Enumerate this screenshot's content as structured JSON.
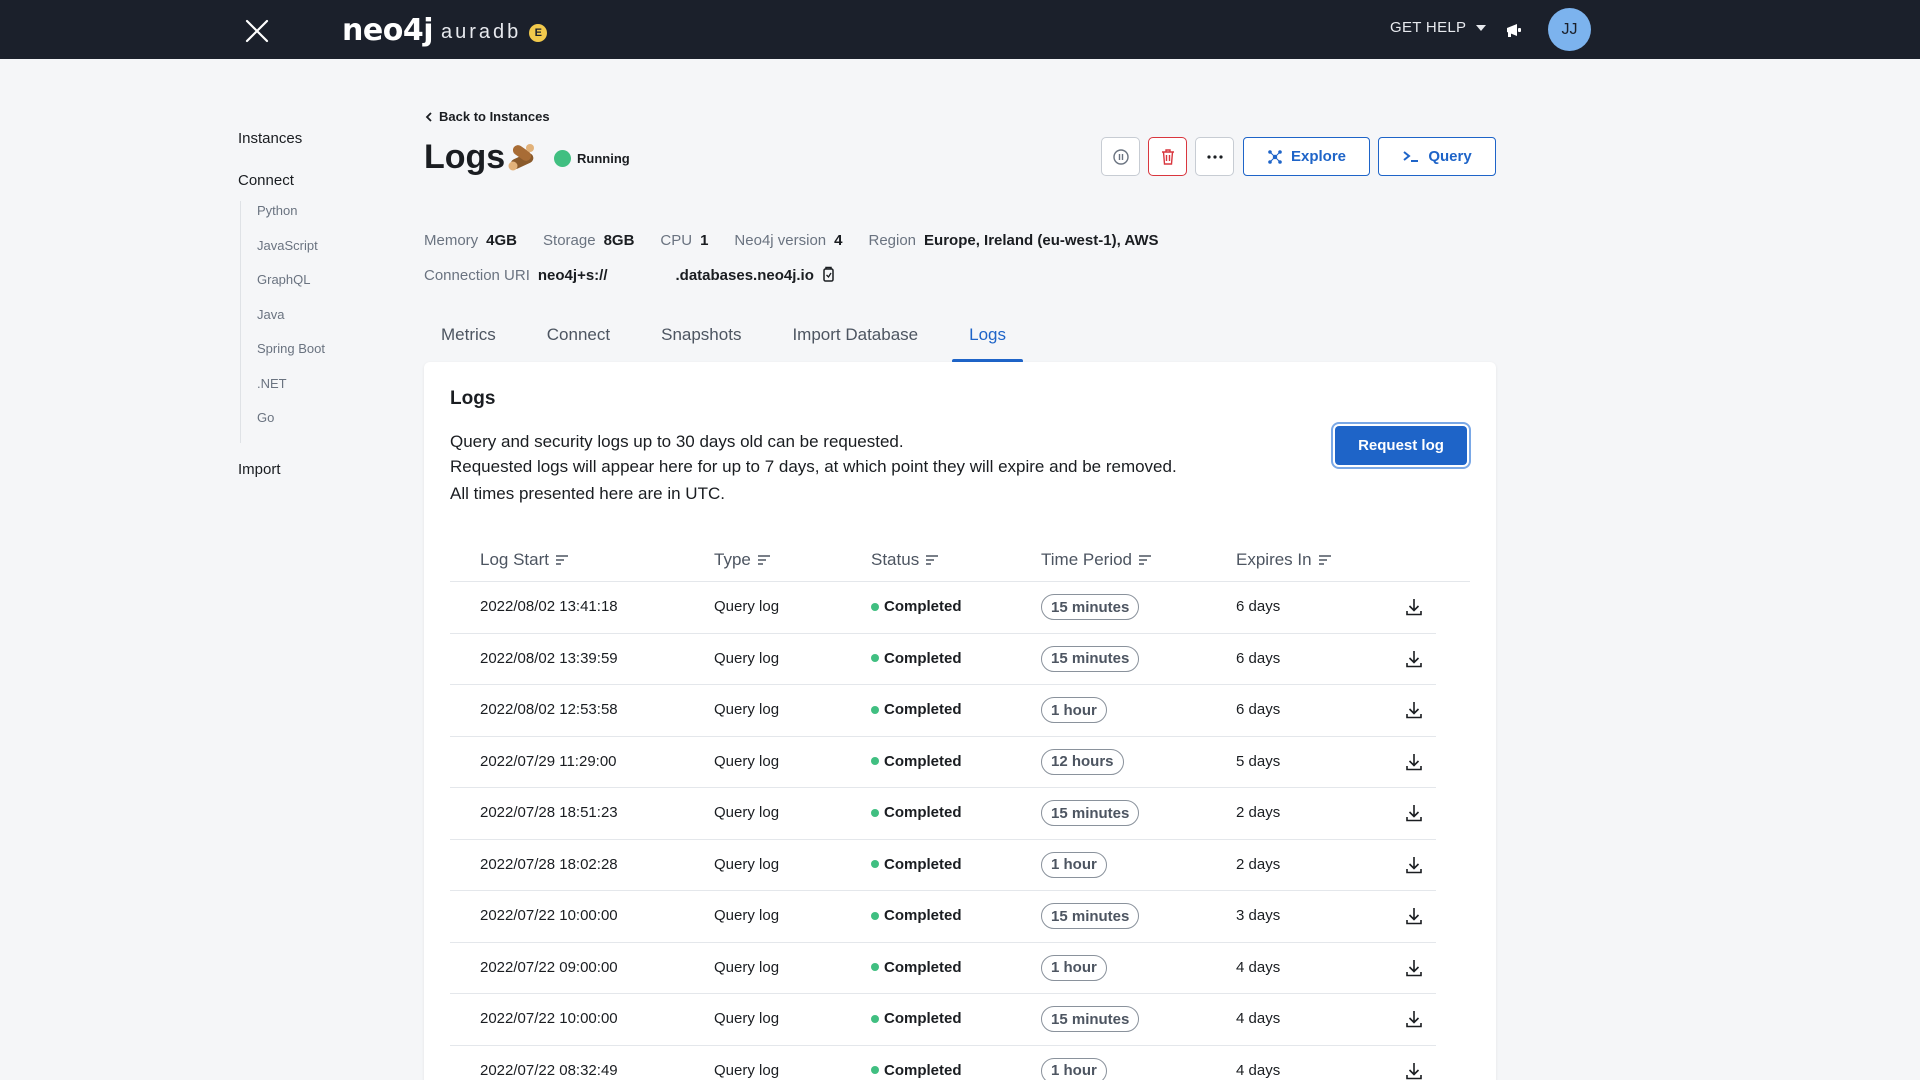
{
  "topbar": {
    "logo_main": "neo4j",
    "logo_sub": "auradb",
    "logo_badge": "E",
    "help_label": "GET HELP",
    "avatar_initials": "JJ"
  },
  "sidebar": {
    "instances": "Instances",
    "connect": "Connect",
    "connect_items": [
      "Python",
      "JavaScript",
      "GraphQL",
      "Java",
      "Spring Boot",
      ".NET",
      "Go"
    ],
    "import": "Import"
  },
  "header": {
    "back_label": "Back to Instances",
    "title": "Logs",
    "status": "Running",
    "explore_label": "Explore",
    "query_label": "Query"
  },
  "meta": {
    "memory_label": "Memory",
    "memory_value": "4GB",
    "storage_label": "Storage",
    "storage_value": "8GB",
    "cpu_label": "CPU",
    "cpu_value": "1",
    "version_label": "Neo4j version",
    "version_value": "4",
    "region_label": "Region",
    "region_value": "Europe, Ireland (eu-west-1), AWS",
    "uri_label": "Connection URI",
    "uri_prefix": "neo4j+s://",
    "uri_suffix": ".databases.neo4j.io"
  },
  "tabs": [
    "Metrics",
    "Connect",
    "Snapshots",
    "Import Database",
    "Logs"
  ],
  "card": {
    "title": "Logs",
    "desc_line1": "Query and security logs up to 30 days old can be requested.",
    "desc_line2": "Requested logs will appear here for up to 7 days, at which point they will expire and be removed.",
    "utc_note": "All times presented here are in UTC.",
    "request_label": "Request log"
  },
  "table": {
    "headers": [
      "Log Start",
      "Type",
      "Status",
      "Time Period",
      "Expires In"
    ],
    "rows": [
      {
        "start": "2022/08/02 13:41:18",
        "type": "Query log",
        "status": "Completed",
        "period": "15 minutes",
        "expires": "6 days"
      },
      {
        "start": "2022/08/02 13:39:59",
        "type": "Query log",
        "status": "Completed",
        "period": "15 minutes",
        "expires": "6 days"
      },
      {
        "start": "2022/08/02 12:53:58",
        "type": "Query log",
        "status": "Completed",
        "period": "1 hour",
        "expires": "6 days"
      },
      {
        "start": "2022/07/29 11:29:00",
        "type": "Query log",
        "status": "Completed",
        "period": "12 hours",
        "expires": "5 days"
      },
      {
        "start": "2022/07/28 18:51:23",
        "type": "Query log",
        "status": "Completed",
        "period": "15 minutes",
        "expires": "2 days"
      },
      {
        "start": "2022/07/28 18:02:28",
        "type": "Query log",
        "status": "Completed",
        "period": "1 hour",
        "expires": "2 days"
      },
      {
        "start": "2022/07/22 10:00:00",
        "type": "Query log",
        "status": "Completed",
        "period": "15 minutes",
        "expires": "3 days"
      },
      {
        "start": "2022/07/22 09:00:00",
        "type": "Query log",
        "status": "Completed",
        "period": "1 hour",
        "expires": "4 days"
      },
      {
        "start": "2022/07/22 10:00:00",
        "type": "Query log",
        "status": "Completed",
        "period": "15 minutes",
        "expires": "4 days"
      },
      {
        "start": "2022/07/22 08:32:49",
        "type": "Query log",
        "status": "Completed",
        "period": "1 hour",
        "expires": "4 days"
      }
    ]
  },
  "colors": {
    "topbar": "#1b202b",
    "accent": "#1e64c8",
    "status_green": "#40bf81",
    "avatar": "#7cb3ee"
  }
}
